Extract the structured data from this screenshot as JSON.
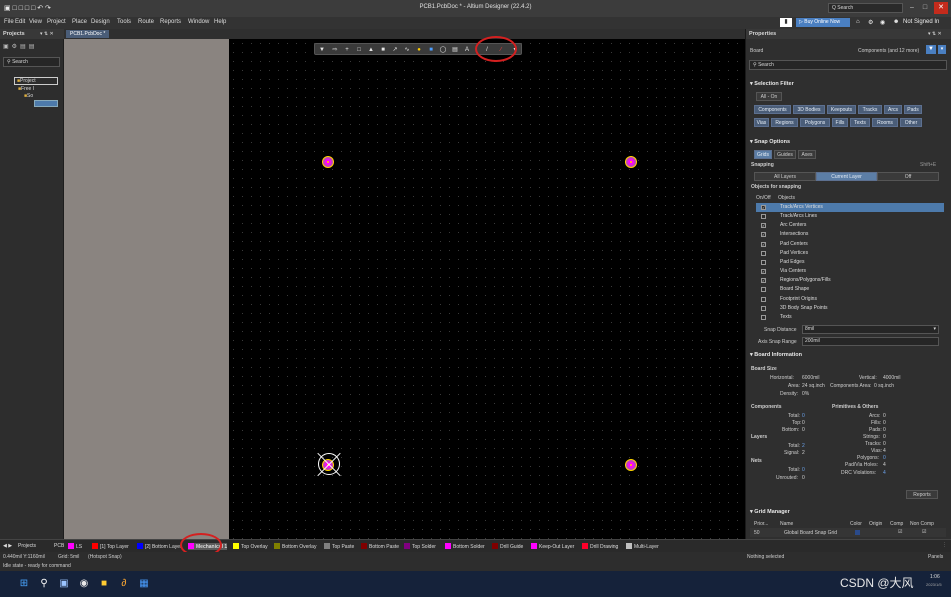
{
  "window": {
    "title": "PCB1.PcbDoc * - Altium Designer (22.4.2)",
    "search_placeholder": "Q Search",
    "not_signed_in": "Not Signed In",
    "buy_online": "Buy Online Now"
  },
  "menu": [
    "File",
    "Edit",
    "View",
    "Project",
    "Place",
    "Design",
    "Tools",
    "Route",
    "Reports",
    "Window",
    "Help"
  ],
  "projects_panel": {
    "title": "Projects",
    "search_placeholder": "Search",
    "tree": [
      "Project",
      "Free I",
      "So"
    ]
  },
  "doc_tab": "PCB1.PcbDoc *",
  "properties": {
    "title": "Properties",
    "board_label": "Board",
    "components_filter": "Components (and 12 more)",
    "search_placeholder": "Search",
    "selection_filter": {
      "header": "Selection Filter",
      "all_on": "All - On",
      "row1": [
        "Components",
        "3D Bodies",
        "Keepouts",
        "Tracks",
        "Arcs",
        "Pads"
      ],
      "row2": [
        "Vias",
        "Regions",
        "Polygons",
        "Fills",
        "Texts",
        "Rooms",
        "Other"
      ]
    },
    "snap_options": {
      "header": "Snap Options",
      "tabs": [
        "Grids",
        "Guides",
        "Axes"
      ],
      "snapping_label": "Snapping",
      "shortcut": "Shift+E",
      "modes": [
        "All Layers",
        "Current Layer",
        "Off"
      ],
      "objects_header": "Objects for snapping",
      "col_onoff": "On/Off",
      "col_objects": "Objects",
      "objects": [
        {
          "name": "Track/Arcs Vertices",
          "on": true
        },
        {
          "name": "Track/Arcs Lines",
          "on": false
        },
        {
          "name": "Arc Centers",
          "on": true
        },
        {
          "name": "Intersections",
          "on": true
        },
        {
          "name": "Pad Centers",
          "on": true
        },
        {
          "name": "Pad Vertices",
          "on": false
        },
        {
          "name": "Pad Edges",
          "on": false
        },
        {
          "name": "Via Centers",
          "on": true
        },
        {
          "name": "Regions/Polygons/Fills",
          "on": true
        },
        {
          "name": "Board Shape",
          "on": false
        },
        {
          "name": "Footprint Origins",
          "on": false
        },
        {
          "name": "3D Body Snap Points",
          "on": false
        },
        {
          "name": "Texts",
          "on": false
        }
      ],
      "snap_distance_label": "Snap Distance",
      "snap_distance": "8mil",
      "axis_range_label": "Axis Snap Range",
      "axis_range": "200mil"
    },
    "board_info": {
      "header": "Board Information",
      "board_size": "Board Size",
      "horizontal_label": "Horizontal:",
      "horizontal": "6000mil",
      "vertical_label": "Vertical:",
      "vertical": "4000mil",
      "area_label": "Area:",
      "area": "24 sq.inch",
      "comp_area_label": "Components Area:",
      "comp_area": "0 sq.inch",
      "density_label": "Density:",
      "density": "0%",
      "components": "Components",
      "prims": "Primitives & Others",
      "total_label": "Total:",
      "total": "0",
      "top_label": "Top:",
      "top": "0",
      "bottom_label": "Bottom:",
      "bottom": "0",
      "arcs_label": "Arcs:",
      "arcs": "0",
      "fills_label": "Fills:",
      "fills": "0",
      "pads_label": "Pads:",
      "pads": "0",
      "strings_label": "Strings:",
      "strings": "0",
      "tracks_label": "Tracks:",
      "tracks": "0",
      "vias_label": "Vias:",
      "vias": "4",
      "polygons_label": "Polygons:",
      "polygons": "0",
      "padvia_label": "Pad/Via Holes:",
      "padvia": "4",
      "drc_label": "DRC Violations:",
      "drc": "4",
      "layers": "Layers",
      "layers_total_label": "Total:",
      "layers_total": "2",
      "signal_label": "Signal:",
      "signal": "2",
      "nets": "Nets",
      "nets_total_label": "Total:",
      "nets_total": "0",
      "unrouted_label": "Unrouted:",
      "unrouted": "0",
      "reports_button": "Reports"
    },
    "grid_manager": {
      "header": "Grid Manager",
      "columns": [
        "Prior...",
        "Name",
        "Color",
        "Origin",
        "Comp",
        "Non Comp"
      ],
      "row": {
        "priority": "50",
        "name": "Global Board Snap Grid"
      }
    },
    "nothing_selected": "Nothing selected",
    "panels_button": "Panels"
  },
  "layer_tabs": {
    "projects": "Projects",
    "pcb": "PCB",
    "ls": "LS",
    "layers": [
      {
        "name": "[1] Top Layer",
        "color": "#ff0000"
      },
      {
        "name": "[2] Bottom Layer",
        "color": "#0000ff"
      },
      {
        "name": "Mechanical 1",
        "color": "#ff00ff"
      },
      {
        "name": "Top Overlay",
        "color": "#ffff00"
      },
      {
        "name": "Bottom Overlay",
        "color": "#808000"
      },
      {
        "name": "Top Paste",
        "color": "#808080"
      },
      {
        "name": "Bottom Paste",
        "color": "#800000"
      },
      {
        "name": "Top Solder",
        "color": "#800080"
      },
      {
        "name": "Bottom Solder",
        "color": "#ff00ff"
      },
      {
        "name": "Drill Guide",
        "color": "#800000"
      },
      {
        "name": "Keep-Out Layer",
        "color": "#ff00ff"
      },
      {
        "name": "Drill Drawing",
        "color": "#ff002a"
      },
      {
        "name": "Multi-Layer",
        "color": "#c0c0c0"
      }
    ]
  },
  "status": {
    "coords": "0.440mil Y:1160mil",
    "grid": "Grid: 5mil",
    "hotspot": "(Hotspot Snap)",
    "idle": "Idle state - ready for command"
  },
  "taskbar": {
    "watermark": "CSDN @大风",
    "time": "1:06",
    "date": "2023/1/5"
  },
  "colors": {
    "accent": "#4d7aab",
    "highlight_ring": "#d42020",
    "pad_color": "#ff00ff"
  }
}
